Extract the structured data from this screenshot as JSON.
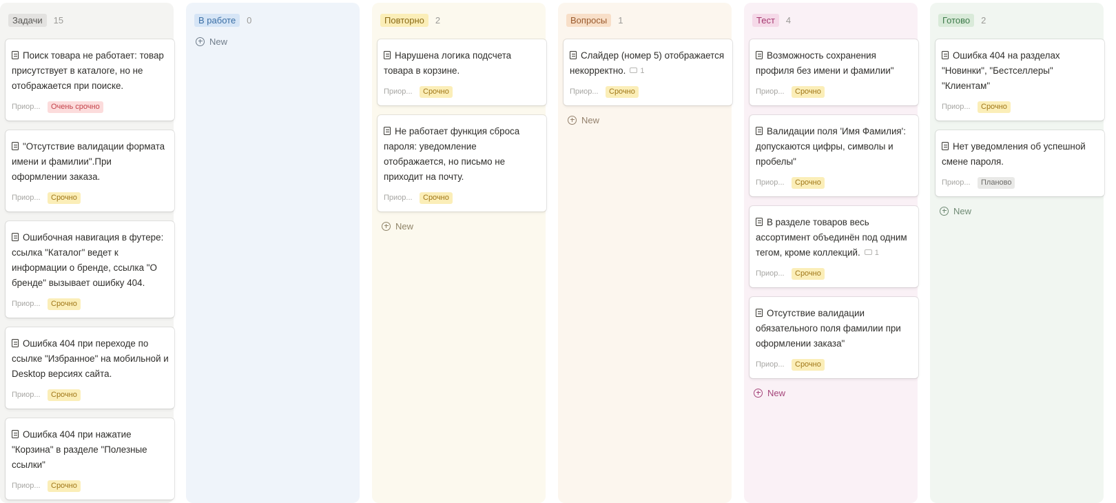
{
  "colors": {
    "todo_bg": "#f4f4f2",
    "inprogress_bg": "#eff4fa",
    "retry_bg": "#fcf9ee",
    "questions_bg": "#fcf6ee",
    "test_bg": "#faf1f6",
    "done_bg": "#f1f6f1",
    "tag_very_urgent_bg": "#fcdcdc",
    "tag_urgent_bg": "#fbeeb8",
    "tag_planned_bg": "#e9e9e7"
  },
  "columns": [
    {
      "title": "Задачи",
      "count": "15",
      "new_label": "",
      "cards": [
        {
          "title": "Поиск товара не работает: товар присутствует в каталоге, но не отображается при поиске.",
          "comments": "",
          "prop": "Приор...",
          "tag": "Очень срочно"
        },
        {
          "title": "\"Отсутствие валидации формата имени и фамилии\".При оформлении заказа.",
          "comments": "",
          "prop": "Приор...",
          "tag": "Срочно"
        },
        {
          "title": "Ошибочная навигация в футере: ссылка \"Каталог\" ведет к информации о бренде, ссылка \"О бренде\" вызывает ошибку 404.",
          "comments": "",
          "prop": "Приор...",
          "tag": "Срочно"
        },
        {
          "title": "Ошибка 404 при переходе по ссылке \"Избранное\" на мобильной и Desktop версиях сайта.",
          "comments": "",
          "prop": "Приор...",
          "tag": "Срочно"
        },
        {
          "title": "Ошибка 404 при нажатие \"Корзина\" в разделе \"Полезные ссылки\"",
          "comments": "",
          "prop": "Приор...",
          "tag": "Срочно"
        }
      ]
    },
    {
      "title": "В работе",
      "count": "0",
      "new_label": "New",
      "cards": []
    },
    {
      "title": "Повторно",
      "count": "2",
      "new_label": "New",
      "cards": [
        {
          "title": "Нарушена логика подсчета товара в корзине.",
          "comments": "",
          "prop": "Приор...",
          "tag": "Срочно"
        },
        {
          "title": "Не работает функция сброса пароля: уведомление отображается, но письмо не приходит на почту.",
          "comments": "",
          "prop": "Приор...",
          "tag": "Срочно"
        }
      ]
    },
    {
      "title": "Вопросы",
      "count": "1",
      "new_label": "New",
      "cards": [
        {
          "title": "Слайдер (номер 5) отображается некорректно.",
          "comments": "1",
          "prop": "Приор...",
          "tag": "Срочно"
        }
      ]
    },
    {
      "title": "Тест",
      "count": "4",
      "new_label": "New",
      "cards": [
        {
          "title": "Возможность сохранения профиля без имени и фамилии\"",
          "comments": "",
          "prop": "Приор...",
          "tag": "Срочно"
        },
        {
          "title": "Валидации поля 'Имя Фамилия': допускаются цифры, символы и пробелы\"",
          "comments": "",
          "prop": "Приор...",
          "tag": "Срочно"
        },
        {
          "title": "В разделе товаров весь ассортимент объединён под одним тегом, кроме коллекций.",
          "comments": "1",
          "prop": "Приор...",
          "tag": "Срочно"
        },
        {
          "title": "Отсутствие валидации обязательного поля фамилии при оформлении заказа\"",
          "comments": "",
          "prop": "Приор...",
          "tag": "Срочно"
        }
      ]
    },
    {
      "title": "Готово",
      "count": "2",
      "new_label": "New",
      "cards": [
        {
          "title": "Ошибка 404 на разделах \"Новинки\", \"Бестселлеры\" \"Клиентам\"",
          "comments": "",
          "prop": "Приор...",
          "tag": "Срочно"
        },
        {
          "title": "Нет уведомления об успешной смене пароля.",
          "comments": "",
          "prop": "Приор...",
          "tag": "Планово"
        }
      ]
    }
  ]
}
